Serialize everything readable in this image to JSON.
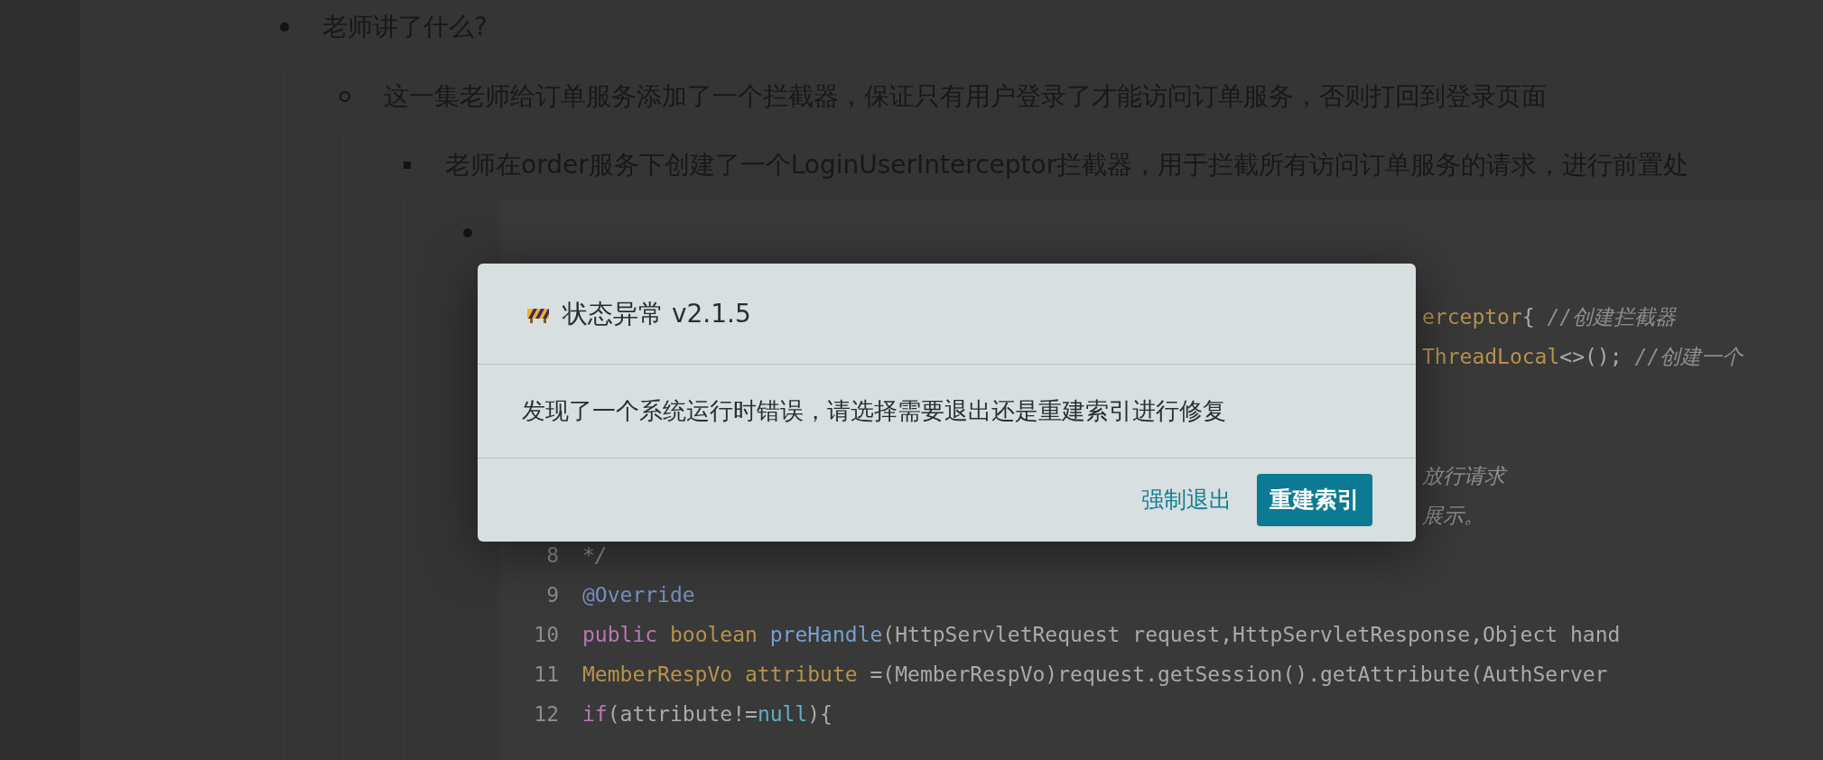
{
  "outline": [
    {
      "text": "老师讲了什么?",
      "children": [
        {
          "text": "这一集老师给订单服务添加了一个拦截器，保证只有用户登录了才能访问订单服务，否则打回到登录页面",
          "children": [
            {
              "text": "老师在order服务下创建了一个LoginUserInterceptor拦截器，用于拦截所有访问订单服务的请求，进行前置处"
            }
          ]
        }
      ]
    }
  ],
  "code": {
    "lines": [
      {
        "kind": "fragment",
        "tokens": [
          {
            "text": "erceptor",
            "kind": "type"
          },
          {
            "text": "{ ",
            "kind": "plain"
          },
          {
            "text": "//创建拦截器",
            "kind": "comment"
          }
        ]
      },
      {
        "kind": "fragment",
        "tokens": [
          {
            "text": "ThreadLocal",
            "kind": "type"
          },
          {
            "text": "<>(); ",
            "kind": "plain"
          },
          {
            "text": "//创建一个",
            "kind": "comment"
          }
        ]
      },
      {
        "kind": "fragment",
        "tokens": [
          {
            "text": "放行请求",
            "kind": "comment"
          }
        ]
      },
      {
        "kind": "fragment",
        "tokens": [
          {
            "text": "展示。",
            "kind": "comment"
          }
        ]
      },
      {
        "kind": "line",
        "number": "8",
        "tokens": [
          {
            "text": "*/",
            "kind": "comment"
          }
        ]
      },
      {
        "kind": "line",
        "number": "9",
        "tokens": [
          {
            "text": "@Override",
            "kind": "annotation"
          }
        ]
      },
      {
        "kind": "line",
        "number": "10",
        "tokens": [
          {
            "text": "public ",
            "kind": "keyword"
          },
          {
            "text": "boolean ",
            "kind": "type"
          },
          {
            "text": "preHandle",
            "kind": "method"
          },
          {
            "text": "(HttpServletRequest request,HttpServletResponse,Object hand",
            "kind": "plain"
          }
        ]
      },
      {
        "kind": "line",
        "number": "11",
        "tokens": [
          {
            "text": "MemberRespVo attribute",
            "kind": "type"
          },
          {
            "text": " =(MemberRespVo)request.getSession().getAttribute(AuthServer",
            "kind": "plain"
          }
        ]
      },
      {
        "kind": "line",
        "number": "12",
        "tokens": [
          {
            "text": "if",
            "kind": "keyword"
          },
          {
            "text": "(attribute!=",
            "kind": "plain"
          },
          {
            "text": "null",
            "kind": "literal"
          },
          {
            "text": "){",
            "kind": "plain"
          }
        ]
      }
    ]
  },
  "dialog": {
    "title": "状态异常 v2.1.5",
    "message": "发现了一个系统运行时错误，请选择需要退出还是重建索引进行修复",
    "buttons": [
      {
        "label": "强制退出",
        "kind": "link"
      },
      {
        "label": "重建索引",
        "kind": "primary"
      }
    ]
  }
}
